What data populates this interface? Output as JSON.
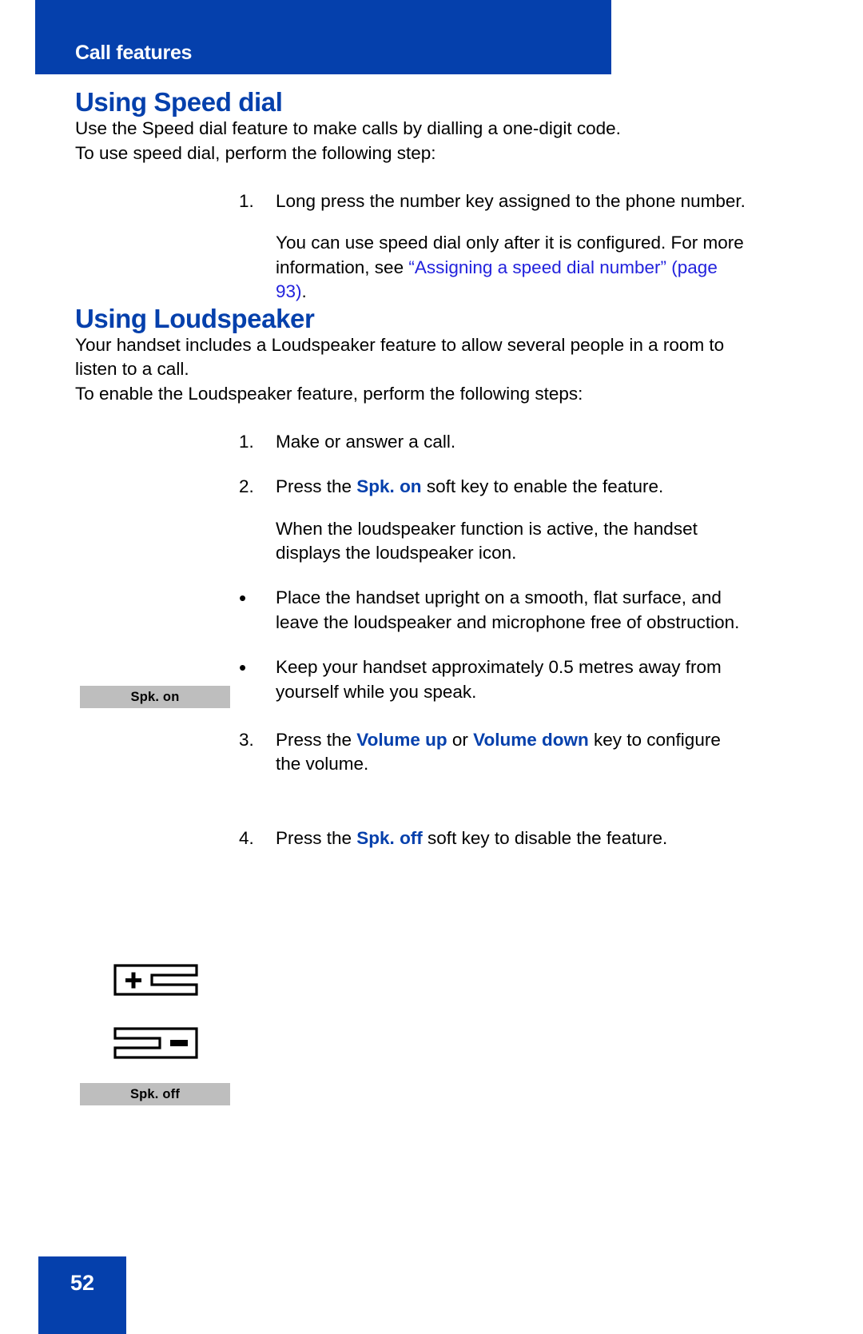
{
  "header": {
    "running_title": "Call features"
  },
  "sections": [
    {
      "heading": "Using Speed dial",
      "intro": "Use the Speed dial feature to make calls by dialling a one-digit code.",
      "lead_in": "To use speed dial, perform the following step:",
      "steps": [
        {
          "marker": "1.",
          "text": "Long press the number key assigned to the phone number.",
          "sub_parts": {
            "before": "You can use speed dial only after it is configured. For more information, see ",
            "link_open_quote": "“Assigning a speed dial number”",
            "link_page": " (page 93)",
            "after": "."
          }
        }
      ]
    },
    {
      "heading": "Using Loudspeaker",
      "intro": "Your handset includes a Loudspeaker feature to allow several people in a room to listen to a call.",
      "lead_in": "To enable the Loudspeaker feature, perform the following steps:",
      "steps": [
        {
          "marker": "1.",
          "text": "Make or answer a call."
        },
        {
          "marker": "2.",
          "before": "Press the ",
          "emphasis": "Spk. on",
          "after": " soft key to enable the feature.",
          "sub": "When the loudspeaker function is active, the handset displays the loudspeaker icon."
        },
        {
          "marker": "•",
          "text": "Place the handset upright on a smooth, flat surface, and leave the loudspeaker and microphone free of obstruction."
        },
        {
          "marker": "•",
          "text": "Keep your handset approximately 0.5 metres away from yourself while you speak."
        },
        {
          "marker": "3.",
          "before": "Press the ",
          "emphasis": "Volume up",
          "middle": " or ",
          "emphasis2": "Volume down",
          "after": " key to configure the volume."
        },
        {
          "marker": "4.",
          "before": "Press the ",
          "emphasis": "Spk. off",
          "after": " soft key to disable the feature."
        }
      ]
    }
  ],
  "margin_graphics": {
    "softkey_spk_on": "Spk. on",
    "softkey_spk_off": "Spk. off",
    "volume_up_icon": "volume-up-key-icon",
    "volume_down_icon": "volume-down-key-icon"
  },
  "footer": {
    "page_number": "52"
  },
  "colors": {
    "brand_blue": "#0540AC",
    "link_blue": "#2222DD",
    "softkey_gray": "#BEBEBE"
  }
}
